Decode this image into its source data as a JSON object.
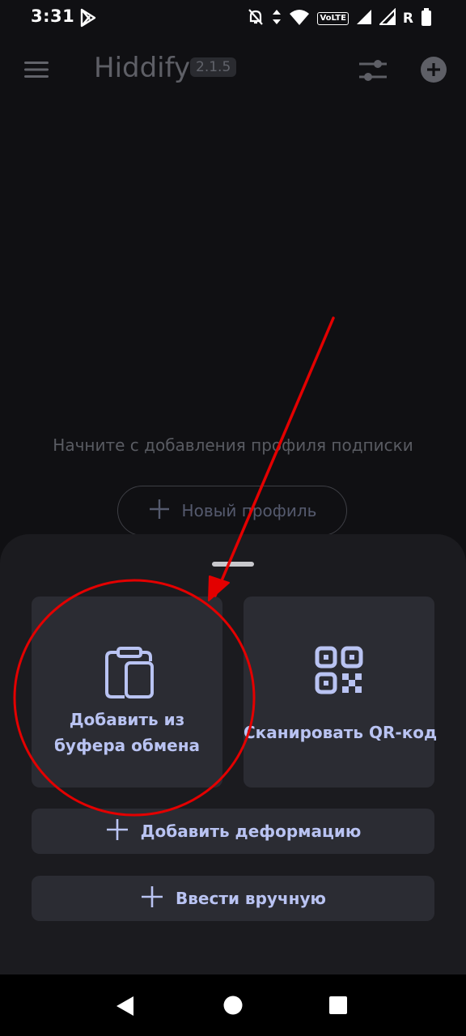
{
  "status_bar": {
    "time": "3:31",
    "network_badge": "VoLTE",
    "roaming_letter": "R"
  },
  "app_bar": {
    "title": "Hiddify",
    "version": "2.1.5",
    "icons": [
      "menu-icon",
      "tune-icon",
      "add-circle-icon"
    ]
  },
  "empty_state": {
    "message": "Начните с добавления профиля подписки",
    "new_profile_label": "Новый профиль"
  },
  "sheet": {
    "clipboard_label": "Добавить из буфера обмена",
    "qr_label": "Сканировать QR-код",
    "warp_label": "Добавить деформацию",
    "manual_label": "Ввести вручную"
  },
  "colors": {
    "background": "#101013",
    "sheet": "#1b1b1f",
    "card": "#2b2c33",
    "accent_text": "#b9c3f2",
    "annotation": "#e30000"
  }
}
